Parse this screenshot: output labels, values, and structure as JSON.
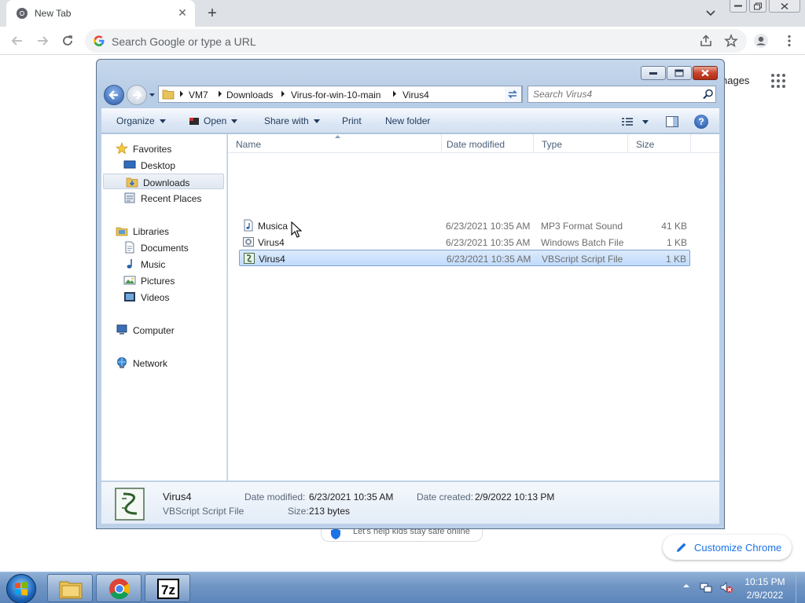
{
  "chrome": {
    "tab_title": "New Tab",
    "omnibox_placeholder": "Search Google or type a URL",
    "images_link": "nages",
    "customize_label": "Customize Chrome",
    "safe_kids_text": "Let's help kids stay safe online"
  },
  "explorer": {
    "breadcrumbs": [
      "VM7",
      "Downloads",
      "Virus-for-win-10-main",
      "Virus4"
    ],
    "search_placeholder": "Search Virus4",
    "commands": {
      "organize": "Organize",
      "open": "Open",
      "share_with": "Share with",
      "print": "Print",
      "new_folder": "New folder"
    },
    "nav": {
      "favorites": "Favorites",
      "desktop": "Desktop",
      "downloads": "Downloads",
      "recent_places": "Recent Places",
      "libraries": "Libraries",
      "documents": "Documents",
      "music": "Music",
      "pictures": "Pictures",
      "videos": "Videos",
      "computer": "Computer",
      "network": "Network"
    },
    "columns": {
      "name": "Name",
      "date_modified": "Date modified",
      "type": "Type",
      "size": "Size"
    },
    "files": [
      {
        "name": "Musica",
        "date": "6/23/2021 10:35 AM",
        "type": "MP3 Format Sound",
        "size": "41 KB",
        "icon": "audio-file-icon"
      },
      {
        "name": "Virus4",
        "date": "6/23/2021 10:35 AM",
        "type": "Windows Batch File",
        "size": "1 KB",
        "icon": "batch-file-icon"
      },
      {
        "name": "Virus4",
        "date": "6/23/2021 10:35 AM",
        "type": "VBScript Script File",
        "size": "1 KB",
        "icon": "vbscript-file-icon",
        "selected": true
      }
    ],
    "details": {
      "name": "Virus4",
      "type": "VBScript Script File",
      "date_modified_label": "Date modified:",
      "date_modified_value": "6/23/2021 10:35 AM",
      "date_created_label": "Date created:",
      "date_created_value": "2/9/2022 10:13 PM",
      "size_label": "Size:",
      "size_value": "213 bytes"
    }
  },
  "taskbar": {
    "apps": [
      "file-explorer",
      "chrome",
      "7-zip"
    ],
    "clock_time": "10:15 PM",
    "clock_date": "2/9/2022"
  },
  "colors": {
    "chrome_accent": "#1a73e8",
    "selection_fill": "#c1dbfc",
    "taskbar": "#6f95c4"
  }
}
